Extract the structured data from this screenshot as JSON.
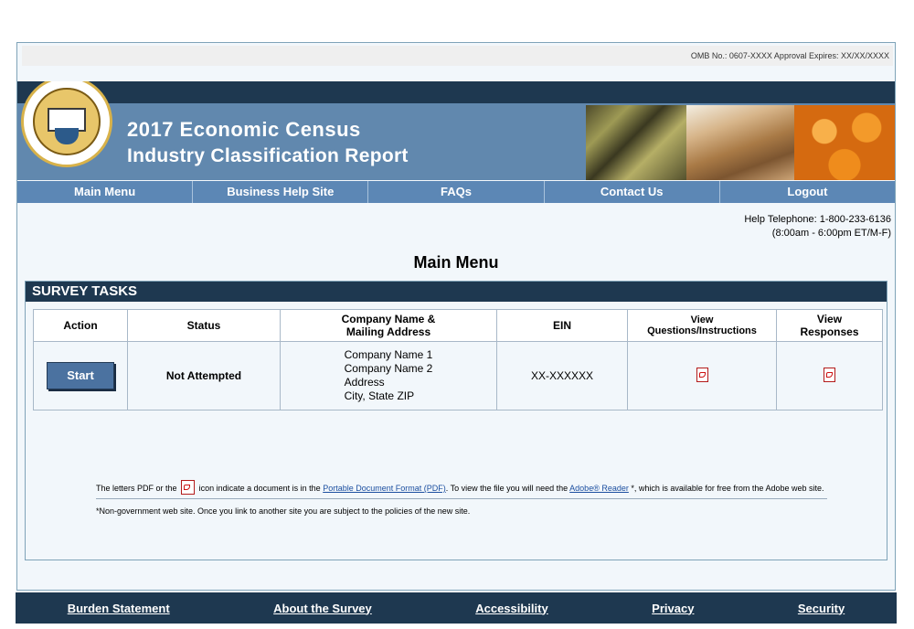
{
  "omb": "OMB No.: 0607-XXXX Approval Expires: XX/XX/XXXX",
  "header": {
    "title_line1": "2017 Economic Census",
    "title_line2": "Industry Classification Report"
  },
  "nav": {
    "items": [
      "Main Menu",
      "Business Help Site",
      "FAQs",
      "Contact Us",
      "Logout"
    ]
  },
  "help": {
    "phone": "Help Telephone: 1-800-233-6136",
    "hours": "(8:00am - 6:00pm ET/M-F)"
  },
  "page_title": "Main Menu",
  "survey": {
    "heading": "SURVEY TASKS",
    "columns": {
      "action": "Action",
      "status": "Status",
      "company_line1": "Company Name &",
      "company_line2": "Mailing Address",
      "ein": "EIN",
      "view_q_line1": "View",
      "view_q_line2": "Questions/Instructions",
      "view_r_line1": "View",
      "view_r_line2": "Responses"
    },
    "row": {
      "action_label": "Start",
      "status": "Not Attempted",
      "address": [
        "Company Name 1",
        "Company Name 2",
        "Address",
        "City, State  ZIP"
      ],
      "ein": "XX-XXXXXX"
    }
  },
  "notes": {
    "pdf_prefix": "The letters PDF or the",
    "pdf_mid": "icon indicate a document is in the",
    "pdf_link": "Portable Document Format (PDF)",
    "pdf_mid2": ". To view the file you will need the",
    "reader_link": "Adobe® Reader",
    "pdf_suffix": "*, which is available for free from the Adobe web site.",
    "disclaimer": "*Non-government web site. Once you link to another site you are subject to the policies of the new site."
  },
  "footer": {
    "links": [
      "Burden Statement",
      "About the Survey",
      "Accessibility",
      "Privacy",
      "Security"
    ]
  },
  "icons": {
    "seal": "census-bureau-seal-icon",
    "pdf": "pdf-icon"
  }
}
